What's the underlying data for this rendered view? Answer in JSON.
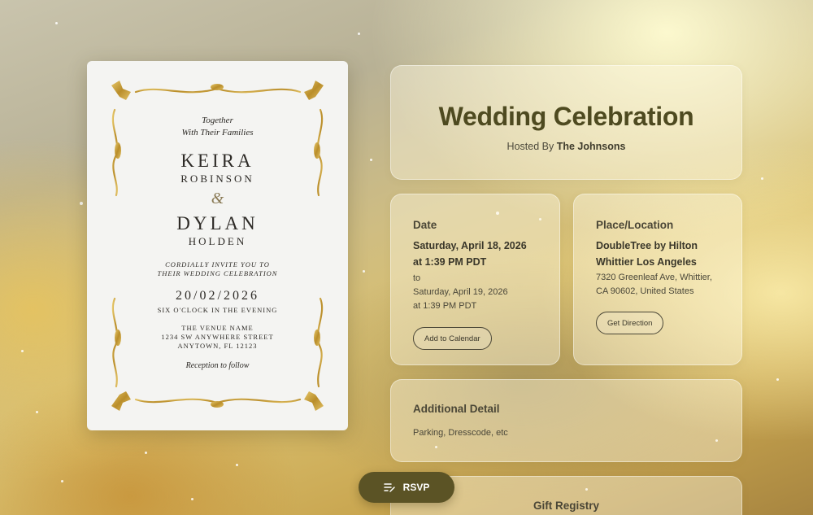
{
  "invitation": {
    "together": "Together",
    "with_families": "With Their Families",
    "bride_first": "KEIRA",
    "bride_last": "ROBINSON",
    "ampersand": "&",
    "groom_first": "DYLAN",
    "groom_last": "HOLDEN",
    "invite_line1": "CORDIALLY INVITE YOU TO",
    "invite_line2": "THEIR WEDDING CELEBRATION",
    "date": "20/02/2026",
    "time": "SIX O'CLOCK IN THE EVENING",
    "venue": "THE VENUE NAME",
    "street": "1234 SW ANYWHERE STREET",
    "city": "ANYTOWN, FL 12123",
    "reception": "Reception to follow"
  },
  "header": {
    "title": "Wedding Celebration",
    "hosted_prefix": "Hosted By",
    "host": "The Johnsons"
  },
  "date_card": {
    "heading": "Date",
    "start_date": "Saturday, April 18, 2026",
    "start_time": "at 1:39 PM PDT",
    "to": "to",
    "end_date": "Saturday, April 19, 2026",
    "end_time": "at 1:39 PM PDT",
    "button": "Add to Calendar"
  },
  "location_card": {
    "heading": "Place/Location",
    "name_line1": "DoubleTree by Hilton",
    "name_line2": "Whittier Los Angeles",
    "address_line1": "7320 Greenleaf Ave, Whittier,",
    "address_line2": "CA 90602, United States",
    "button": "Get Direction"
  },
  "additional": {
    "heading": "Additional Detail",
    "text": "Parking, Dresscode, etc"
  },
  "gift": {
    "heading": "Gift Registry"
  },
  "rsvp": {
    "label": "RSVP",
    "icon": "rsvp-list-icon"
  },
  "colors": {
    "accent": "#5b5325",
    "title": "#4e4a20",
    "gold": "#c9a13a"
  }
}
